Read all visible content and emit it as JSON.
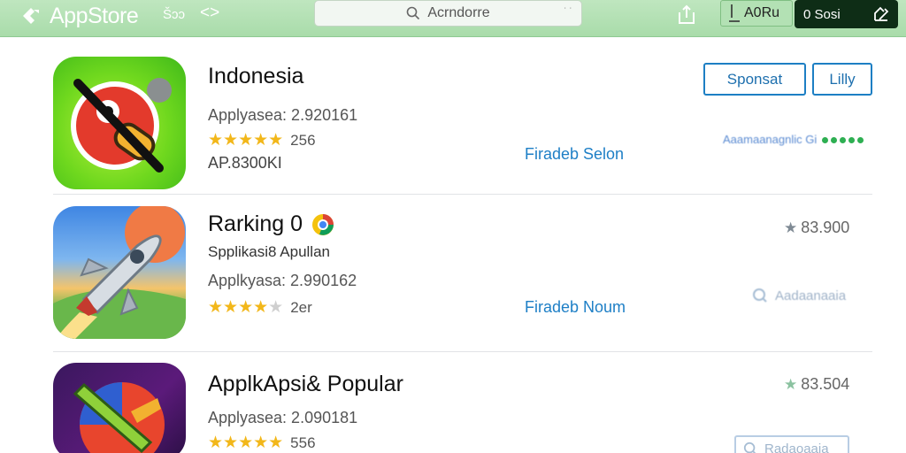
{
  "header": {
    "logo_text": "AppStore",
    "nav_back": "‹̸ ǝɔ",
    "nav_back_text": "Šɔɔ",
    "nav_arrows": "<>",
    "search_placeholder": "Acrndorre",
    "search_dots": "˙ ˙",
    "account_label": "A0Ru",
    "store_label": "0 Sosi",
    "icons": [
      "apple-logo-icon",
      "search-icon",
      "share-icon",
      "download-icon",
      "edit-icon"
    ]
  },
  "apps": [
    {
      "name": "Indonesia",
      "line1": "Applyasea: 2.920161",
      "rating_stars": 5,
      "reviews": "256",
      "line3": "AP.8300KI",
      "feature_link": "Firadeb Selon",
      "button_primary": "Sponsat",
      "button_secondary": "Lilly",
      "blurred_link": "Aaamaanagnlic Gi",
      "icon": "red-bird-icon"
    },
    {
      "name": "Rarking 0",
      "subtitle": "Spplikasi8 Apullan",
      "line1": "Applkyasa: 2.990162",
      "rating_stars": 4,
      "reviews": "2er",
      "feature_link": "Firadeb Noum",
      "price": "83.900",
      "faded_action": "Aadaanaaia",
      "icon": "rocket-icon"
    },
    {
      "name": "ApplkApsi& Popular",
      "line1": "Applyasea: 2.090181",
      "rating_stars": 5,
      "reviews": "556",
      "price": "83.504",
      "faded_action": "Radaoaaia",
      "icon": "popular-game-icon"
    }
  ],
  "colors": {
    "header_green": "#a9dcaa",
    "accent_blue": "#1d7fc4",
    "star_gold": "#f2b71a",
    "store_dark": "#0e2d16"
  }
}
